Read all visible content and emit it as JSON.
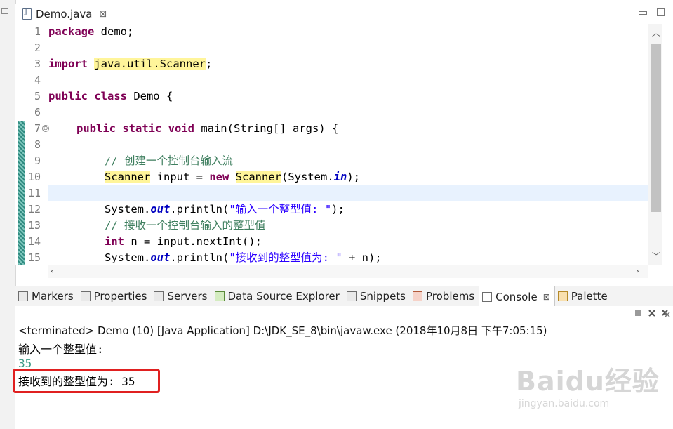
{
  "editor": {
    "tab_label": "Demo.java",
    "tab_close": "⊠",
    "lines": [
      {
        "n": "1"
      },
      {
        "n": "2"
      },
      {
        "n": "3"
      },
      {
        "n": "4"
      },
      {
        "n": "5"
      },
      {
        "n": "6"
      },
      {
        "n": "7"
      },
      {
        "n": "8"
      },
      {
        "n": "9"
      },
      {
        "n": "10"
      },
      {
        "n": "11"
      },
      {
        "n": "12"
      },
      {
        "n": "13"
      },
      {
        "n": "14"
      },
      {
        "n": "15"
      }
    ],
    "code": {
      "l1_kw": "package",
      "l1_rest": " demo;",
      "l3_kw": "import",
      "l3_sp": " ",
      "l3_hl": "java.util.Scanner",
      "l3_rest": ";",
      "l5_kw": "public class",
      "l5_rest": " Demo {",
      "l7_kw": "public static void",
      "l7_rest": " main(String[] args) {",
      "l9_cm": "// 创建一个控制台输入流",
      "l10_hl1": "Scanner",
      "l10_a": " input = ",
      "l10_kw": "new",
      "l10_b": " ",
      "l10_hl2": "Scanner",
      "l10_c": "(System.",
      "l10_fld": "in",
      "l10_d": ");",
      "l12_a": "System.",
      "l12_fld": "out",
      "l12_b": ".println(",
      "l12_str": "\"输入一个整型值: \"",
      "l12_c": ");",
      "l13_cm": "// 接收一个控制台输入的整型值",
      "l14_kw": "int",
      "l14_rest": " n = input.nextInt();",
      "l15_a": "System.",
      "l15_fld": "out",
      "l15_b": ".println(",
      "l15_str": "\"接收到的整型值为: \"",
      "l15_c": " + n);"
    }
  },
  "panel": {
    "tabs": [
      {
        "label": "Markers"
      },
      {
        "label": "Properties"
      },
      {
        "label": "Servers"
      },
      {
        "label": "Data Source Explorer"
      },
      {
        "label": "Snippets"
      },
      {
        "label": "Problems"
      },
      {
        "label": "Console",
        "close": "⊠"
      },
      {
        "label": "Palette"
      }
    ]
  },
  "console": {
    "status": "<terminated> Demo (10) [Java Application] D:\\JDK_SE_8\\bin\\javaw.exe (2018年10月8日 下午7:05:15)",
    "output_prompt": "输入一个整型值:",
    "user_input": "35",
    "output_result": "接收到的整型值为: 35"
  },
  "watermark": {
    "logo": "Baidu经验",
    "url": "jingyan.baidu.com"
  },
  "colors": {
    "keyword": "#7f0055",
    "comment": "#3f7f5f",
    "string": "#2a00ff",
    "field": "#0000c0",
    "highlight": "#fff59a",
    "current_line": "#e8f2fe",
    "console_input": "#3c9a86",
    "annotation_box": "#e02020"
  }
}
